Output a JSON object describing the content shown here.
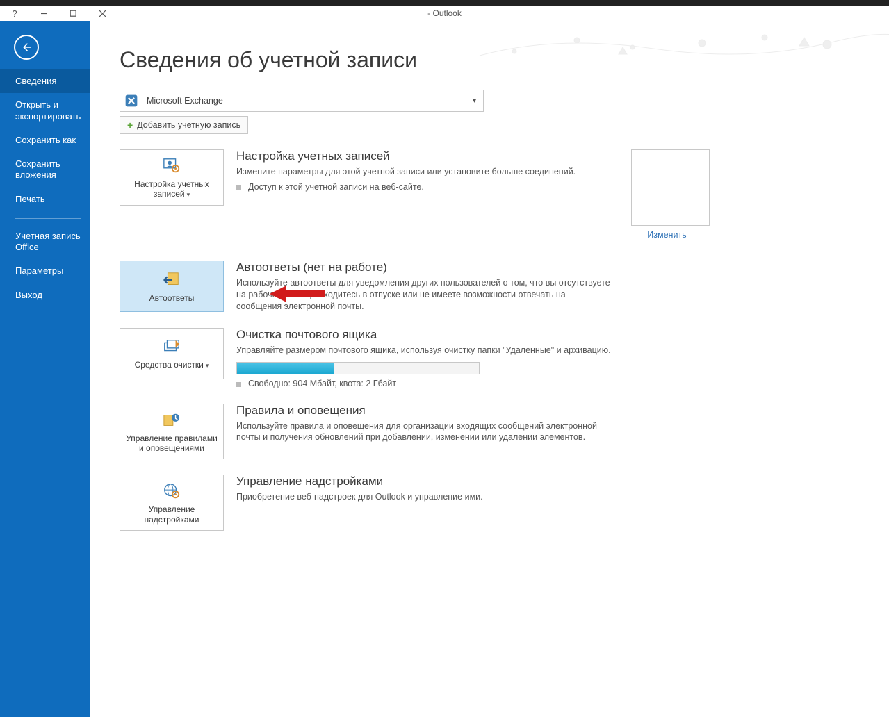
{
  "window": {
    "title": "- Outlook"
  },
  "sidebar": {
    "items": [
      "Сведения",
      "Открыть и экспортировать",
      "Сохранить как",
      "Сохранить вложения",
      "Печать",
      "Учетная запись Office",
      "Параметры",
      "Выход"
    ]
  },
  "page": {
    "title": "Сведения об учетной записи",
    "account_type": "Microsoft Exchange",
    "add_account": "Добавить учетную запись"
  },
  "sections": {
    "account": {
      "tile": "Настройка учетных записей",
      "heading": "Настройка учетных записей",
      "desc": "Измените параметры для этой учетной записи или установите больше соединений.",
      "bullet": "Доступ к этой учетной записи на веб-сайте.",
      "change": "Изменить"
    },
    "auto": {
      "tile": "Автоответы",
      "heading": "Автоответы (нет на работе)",
      "desc": "Используйте автоответы для уведомления других пользователей о том, что вы отсутствуете на рабочем месте, находитесь в отпуске или не имеете возможности отвечать на сообщения электронной почты."
    },
    "cleanup": {
      "tile": "Средства очистки",
      "heading": "Очистка почтового ящика",
      "desc": "Управляйте размером почтового ящика, используя очистку папки \"Удаленные\" и архивацию.",
      "quota": "Свободно: 904 Мбайт, квота: 2 Гбайт"
    },
    "rules": {
      "tile": "Управление правилами и оповещениями",
      "heading": "Правила и оповещения",
      "desc": "Используйте правила и оповещения для организации входящих сообщений электронной почты и получения обновлений при добавлении, изменении или удалении элементов."
    },
    "addins": {
      "tile": "Управление надстройками",
      "heading": "Управление надстройками",
      "desc": "Приобретение веб-надстроек для Outlook и управление ими."
    }
  }
}
